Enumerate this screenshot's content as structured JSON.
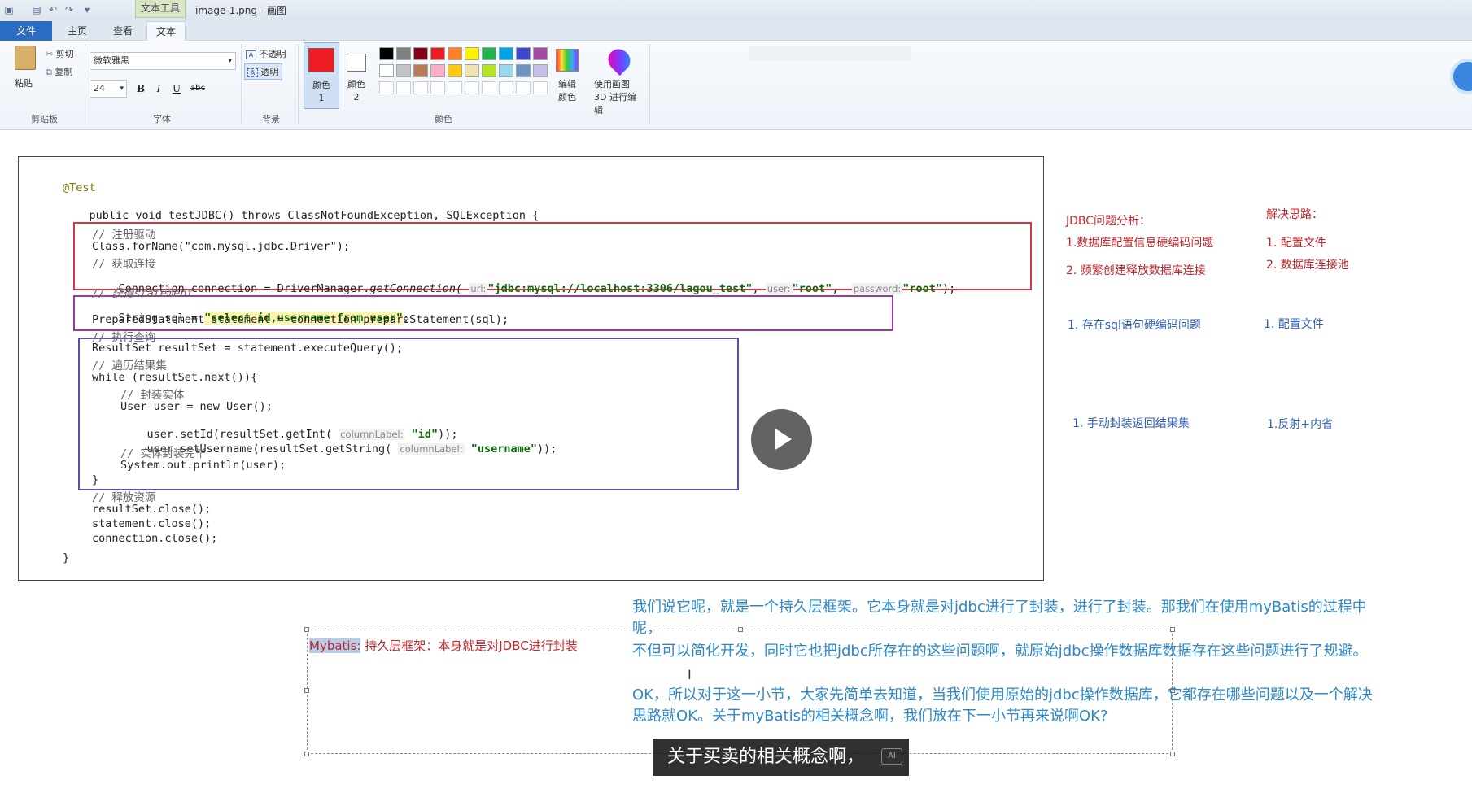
{
  "window": {
    "context_tab": "文本工具",
    "title": "image-1.png - 画图"
  },
  "tabs": [
    "文件",
    "主页",
    "查看",
    "文本"
  ],
  "ribbon": {
    "clipboard": {
      "paste": "粘贴",
      "cut": "剪切",
      "copy": "复制",
      "label": "剪贴板"
    },
    "font": {
      "family": "微软雅黑",
      "size": "24",
      "bold": "B",
      "italic": "I",
      "underline": "U",
      "strike": "abc",
      "label": "字体"
    },
    "background": {
      "opaque": "不透明",
      "transparent": "透明",
      "label": "背景"
    },
    "colors": {
      "color1": "颜色 1",
      "color2": "颜色 2",
      "edit": "编辑颜色",
      "paint3d": "使用画图 3D 进行编辑",
      "label": "颜色",
      "palette_row1": [
        "#000000",
        "#7f7f7f",
        "#880015",
        "#ed1c24",
        "#ff7f27",
        "#fff200",
        "#22b14c",
        "#00a2e8",
        "#3f48cc",
        "#a349a4"
      ],
      "palette_row2": [
        "#ffffff",
        "#c3c3c3",
        "#b97a57",
        "#ffaec9",
        "#ffc90e",
        "#efe4b0",
        "#b5e61d",
        "#99d9ea",
        "#7092be",
        "#c8bfe7"
      ],
      "color1_hex": "#ed1c24",
      "color2_hex": "#ffffff"
    }
  },
  "code": {
    "annotation": "@Test",
    "signature": "public void testJDBC() throws ClassNotFoundException, SQLException {",
    "c_register": "// 注册驱动",
    "forname": "Class.forName(\"com.mysql.jdbc.Driver\");",
    "c_conn": "// 获取连接",
    "conn": {
      "pre": "Connection connection = DriverManager.",
      "method": "getConnection(",
      "h_url": "url:",
      "url": "\"jdbc:mysql://localhost:3306/lagou_test\"",
      "h_user": "user:",
      "user": "\"root\"",
      "h_pass": "password:",
      "pass": "\"root\"",
      "end": ");"
    },
    "c_stmt": "// 获得statement",
    "sql": {
      "pre": "String sql = ",
      "str": "\"select id,username from user\"",
      "end": ";"
    },
    "prepare": "PreparedStatement statement = connection.prepareStatement(sql);",
    "c_exec": "// 执行查询",
    "rs": "ResultSet resultSet = statement.executeQuery();",
    "c_iter": "// 遍历结果集",
    "while": "while (resultSet.next()){",
    "c_wrap": "// 封装实体",
    "newuser": "User user = new User();",
    "setid": {
      "pre": "user.setId(resultSet.getInt(",
      "hint": "columnLabel:",
      "str": "\"id\"",
      "end": "));"
    },
    "setname": {
      "pre": "user.setUsername(resultSet.getString(",
      "hint": "columnLabel:",
      "str": "\"username\"",
      "end": "));"
    },
    "c_done": "// 实体封装完毕",
    "println": "System.out.println(user);",
    "close_brace": "}",
    "c_release": "// 释放资源",
    "rs_close": "resultSet.close();",
    "st_close": "statement.close();",
    "cn_close": "connection.close();",
    "end_brace": "}"
  },
  "notes": {
    "analysis_title": "JDBC问题分析：",
    "solution_title": "解决思路：",
    "p1": "1.数据库配置信息硬编码问题",
    "p2": "2. 频繁创建释放数据库连接",
    "s1": "1. 配置文件",
    "s2": "2. 数据库连接池",
    "p3": "1. 存在sql语句硬编码问题",
    "s3": "1. 配置文件",
    "p4": "1. 手动封装返回结果集",
    "s4": "1.反射+内省"
  },
  "mybatis_note": {
    "label": "Mybatis:",
    "text": "持久层框架：本身就是对JDBC进行封装"
  },
  "transcript": {
    "line1": "我们说它呢，就是一个持久层框架。它本身就是对jdbc进行了封装，进行了封装。那我们在使用myBatis的过程中",
    "line2": "呢，",
    "line3": "不但可以简化开发，同时它也把jdbc所存在的这些问题啊，就原始jdbc操作数据库数据存在这些问题进行了规避。",
    "line4": "OK，所以对于这一小节，大家先简单去知道，当我们使用原始的jdbc操作数据库，它都存在哪些问题以及一个解决",
    "line5": "思路就OK。关于myBatis的相关概念啊，我们放在下一小节再来说啊OK?"
  },
  "subtitle": "关于买卖的相关概念啊，"
}
